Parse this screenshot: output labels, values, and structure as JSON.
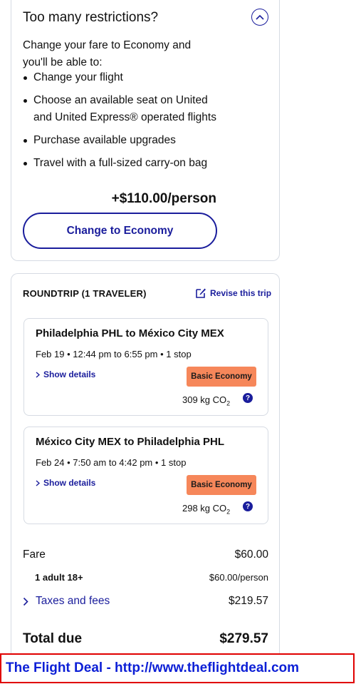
{
  "restrictions": {
    "title": "Too many restrictions?",
    "intro": "Change your fare to Economy and you'll be able to:",
    "benefits": [
      "Change your flight",
      "Choose an available seat on United and United Express® operated flights",
      "Purchase available upgrades",
      "Travel with a full-sized carry-on bag"
    ],
    "price": "+$110.00/person",
    "button_label": "Change to Economy"
  },
  "trip": {
    "label": "ROUNDTRIP (1 TRAVELER)",
    "revise_label": "Revise this trip",
    "segments": [
      {
        "route": "Philadelphia PHL to México City MEX",
        "time": "Feb 19 • 12:44 pm to 6:55 pm • 1 stop",
        "details_label": "Show details",
        "fare_class": "Basic Economy",
        "co2_value": "309 kg CO",
        "co2_sub": "2"
      },
      {
        "route": "México City MEX to Philadelphia PHL",
        "time": "Feb 24 • 7:50 am to 4:42 pm • 1 stop",
        "details_label": "Show details",
        "fare_class": "Basic Economy",
        "co2_value": "298 kg CO",
        "co2_sub": "2"
      }
    ]
  },
  "summary": {
    "fare_label": "Fare",
    "fare_value": "$60.00",
    "adult_label": "1 adult 18+",
    "adult_value": "$60.00/person",
    "taxes_label": "Taxes and fees",
    "taxes_value": "$219.57",
    "total_label": "Total due",
    "total_value": "$279.57"
  },
  "banner": {
    "text": "The Flight Deal - http://www.theflightdeal.com"
  },
  "colors": {
    "accent": "#1a1d9c",
    "badge": "#f6875a",
    "banner_text": "#0c1fd6",
    "banner_border": "#e00000"
  }
}
